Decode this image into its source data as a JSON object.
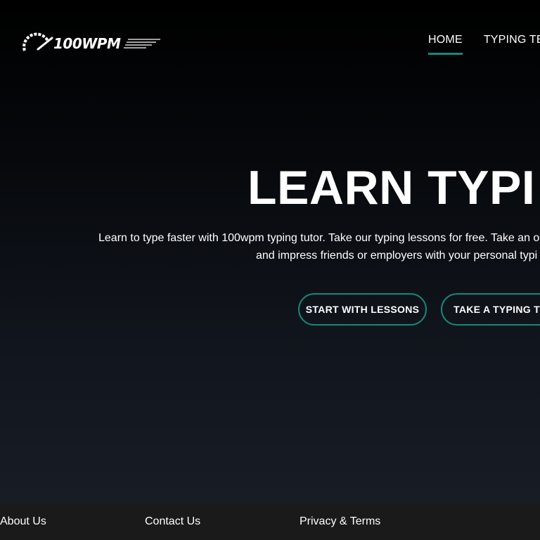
{
  "header": {
    "logo_text": "100WPM",
    "nav": [
      {
        "label": "HOME",
        "active": true
      },
      {
        "label": "TYPING TE",
        "active": false
      }
    ]
  },
  "hero": {
    "title": "LEARN TYPI",
    "description_line1": "Learn to type faster with 100wpm typing tutor. Take our typing lessons for free. Take an o",
    "description_line2": "and impress friends or employers with your personal typi",
    "buttons": {
      "lessons": "START WITH LESSONS",
      "test": "TAKE A TYPING TE"
    }
  },
  "footer": {
    "links": [
      "About Us",
      "Contact Us",
      "Privacy & Terms"
    ]
  },
  "colors": {
    "accent": "#15887a",
    "background_top": "#000000",
    "background_bottom": "#181c25",
    "footer_bg": "#1a1a1a",
    "text": "#ffffff"
  },
  "icons": {
    "logo": "speedometer-icon"
  }
}
